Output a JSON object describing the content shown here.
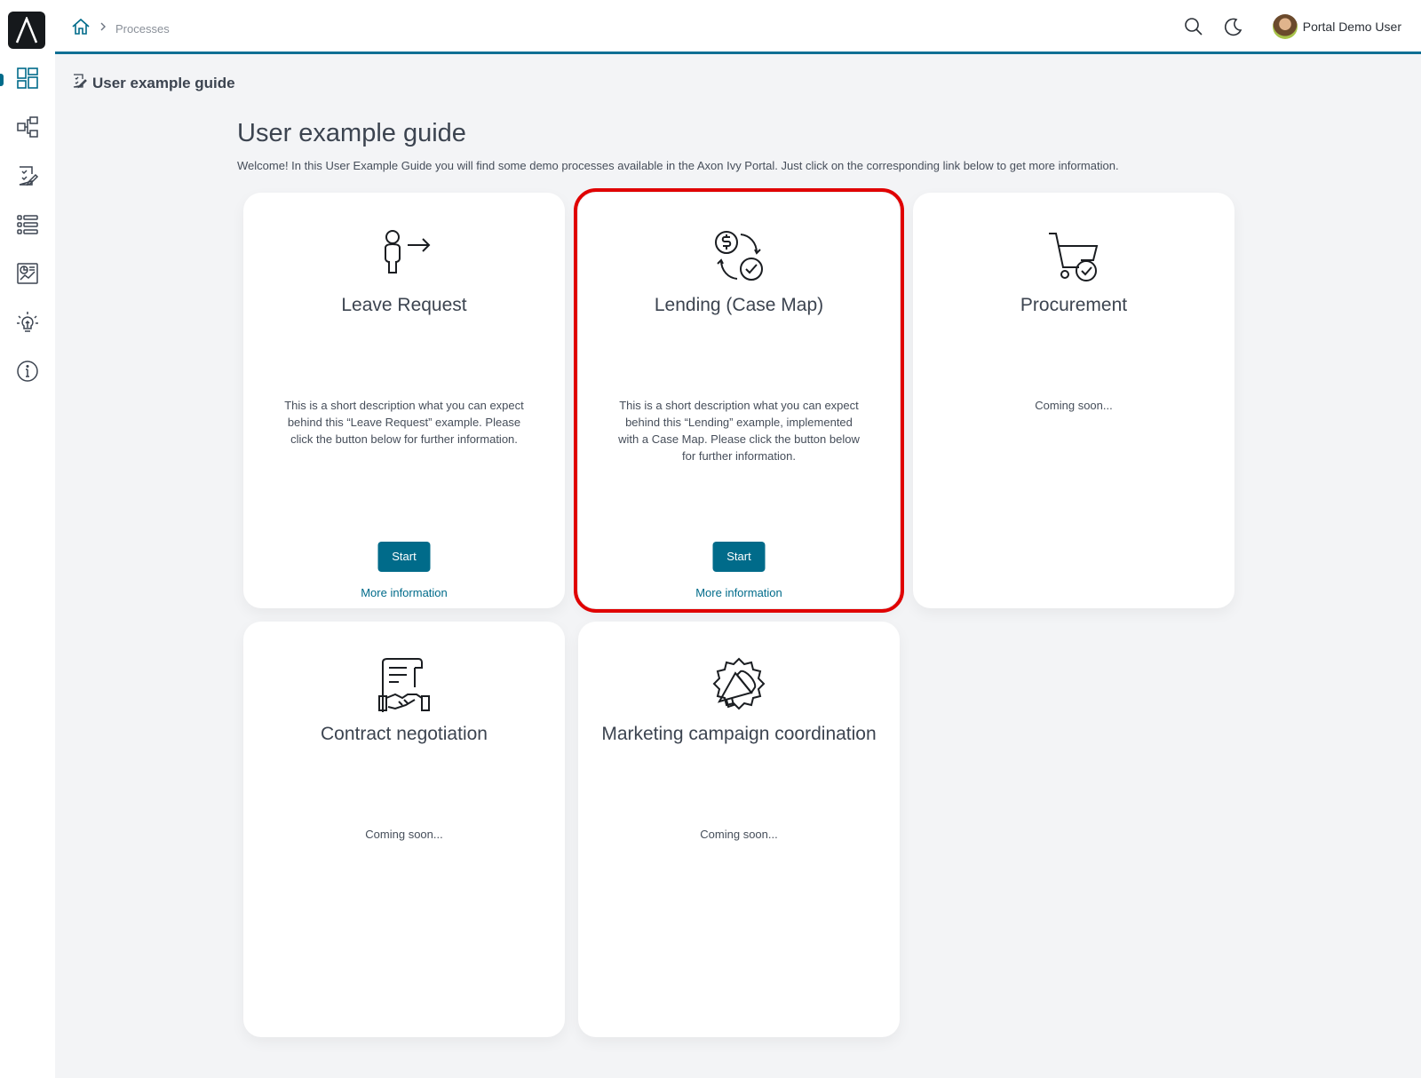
{
  "topbar": {
    "breadcrumb_home_icon": "home-icon",
    "breadcrumb_current": "Processes",
    "user_name": "Portal Demo User"
  },
  "sidebar": {
    "items": [
      {
        "icon": "dashboard-icon",
        "active": true
      },
      {
        "icon": "processes-icon"
      },
      {
        "icon": "tasks-icon"
      },
      {
        "icon": "cases-icon"
      },
      {
        "icon": "statistics-icon"
      },
      {
        "icon": "lightbulb-icon"
      },
      {
        "icon": "info-icon"
      }
    ]
  },
  "page": {
    "header_title": "User example guide",
    "title": "User example guide",
    "description": "Welcome! In this User Example Guide you will find some demo processes available in the Axon Ivy Portal. Just click on the corresponding link below to get more information."
  },
  "cards": [
    {
      "title": "Leave Request",
      "description": "This is a short description what you can expect behind this “Leave Request” example. Please click the button below for further information.",
      "start_label": "Start",
      "more_label": "More information",
      "icon": "person-leaving-icon"
    },
    {
      "title": "Lending (Case Map)",
      "description": "This is a short description what you can expect behind this “Lending” example, implemented with a Case Map. Please click the button below for further information.",
      "start_label": "Start",
      "more_label": "More information",
      "icon": "money-exchange-icon"
    },
    {
      "title": "Procurement",
      "description": "Coming soon...",
      "icon": "shopping-cart-check-icon"
    },
    {
      "title": "Contract negotiation",
      "description": "Coming soon...",
      "icon": "contract-handshake-icon"
    },
    {
      "title": "Marketing campaign coordination",
      "description": "Coming soon...",
      "icon": "megaphone-icon"
    }
  ],
  "colors": {
    "accent": "#006b8a",
    "highlight": "#e00000",
    "background": "#f3f4f6"
  }
}
